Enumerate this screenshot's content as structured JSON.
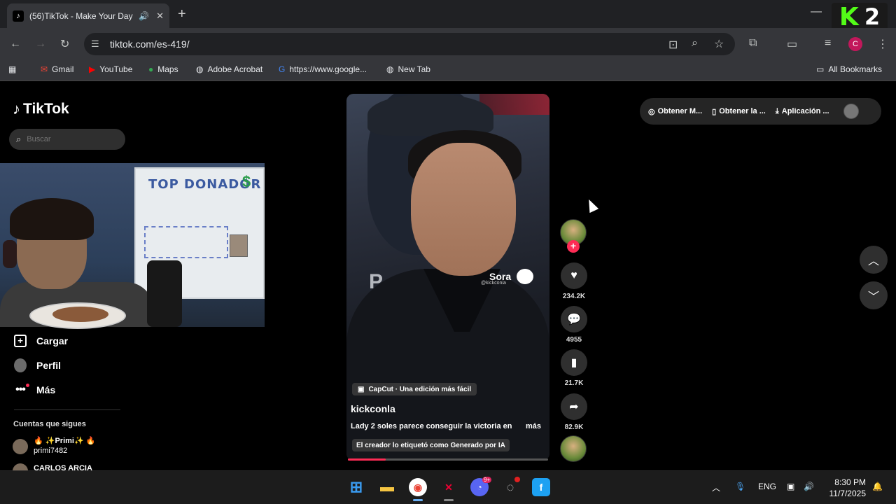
{
  "browser": {
    "tab_title": "(56)TikTok - Make Your Day",
    "url": "tiktok.com/es-419/",
    "bookmarks": [
      "Gmail",
      "YouTube",
      "Maps",
      "Adobe Acrobat",
      "https://www.google...",
      "New Tab"
    ],
    "all_bookmarks": "All Bookmarks",
    "profile_letter": "C"
  },
  "overlay": {
    "kick_letter": "K",
    "kick_number": "2"
  },
  "sidebar": {
    "logo": "TikTok",
    "search_placeholder": "Buscar",
    "nav": [
      {
        "label": "Cargar",
        "icon": "plus-square-icon"
      },
      {
        "label": "Perfil",
        "icon": "avatar-icon"
      },
      {
        "label": "Más",
        "icon": "more-dots-icon"
      }
    ],
    "following_heading": "Cuentas que sigues",
    "following": [
      {
        "display": "✨Primi✨",
        "handle": "primi7482"
      },
      {
        "display": "CARLOS ARCIA",
        "handle": ""
      }
    ]
  },
  "webcam": {
    "whiteboard_title": "TOP DONADOR",
    "whiteboard_symbol": "$"
  },
  "video": {
    "watermark": "Sora",
    "watermark_sub": "@kickconia",
    "letter": "P",
    "capcut_label": "CapCut · Una edición más fácil",
    "username": "kickconla",
    "description": "Lady 2 soles parece conseguir la victoria en",
    "more": "más",
    "ai_label": "El creador lo etiquetó como Generado por IA",
    "progress": 0.19
  },
  "actions": {
    "likes": "234.2K",
    "comments": "4955",
    "saves": "21.7K",
    "shares": "82.9K"
  },
  "topbar": {
    "items": [
      "Obtener M...",
      "Obtener la ...",
      "Aplicación ..."
    ]
  },
  "taskbar": {
    "language": "ENG",
    "time": "8:30 PM",
    "date": "11/7/2025",
    "discord_badge": "9+"
  },
  "colors": {
    "tiktok_red": "#fe2c55",
    "kick_green": "#53fc18",
    "chrome_dark": "#35363a"
  }
}
